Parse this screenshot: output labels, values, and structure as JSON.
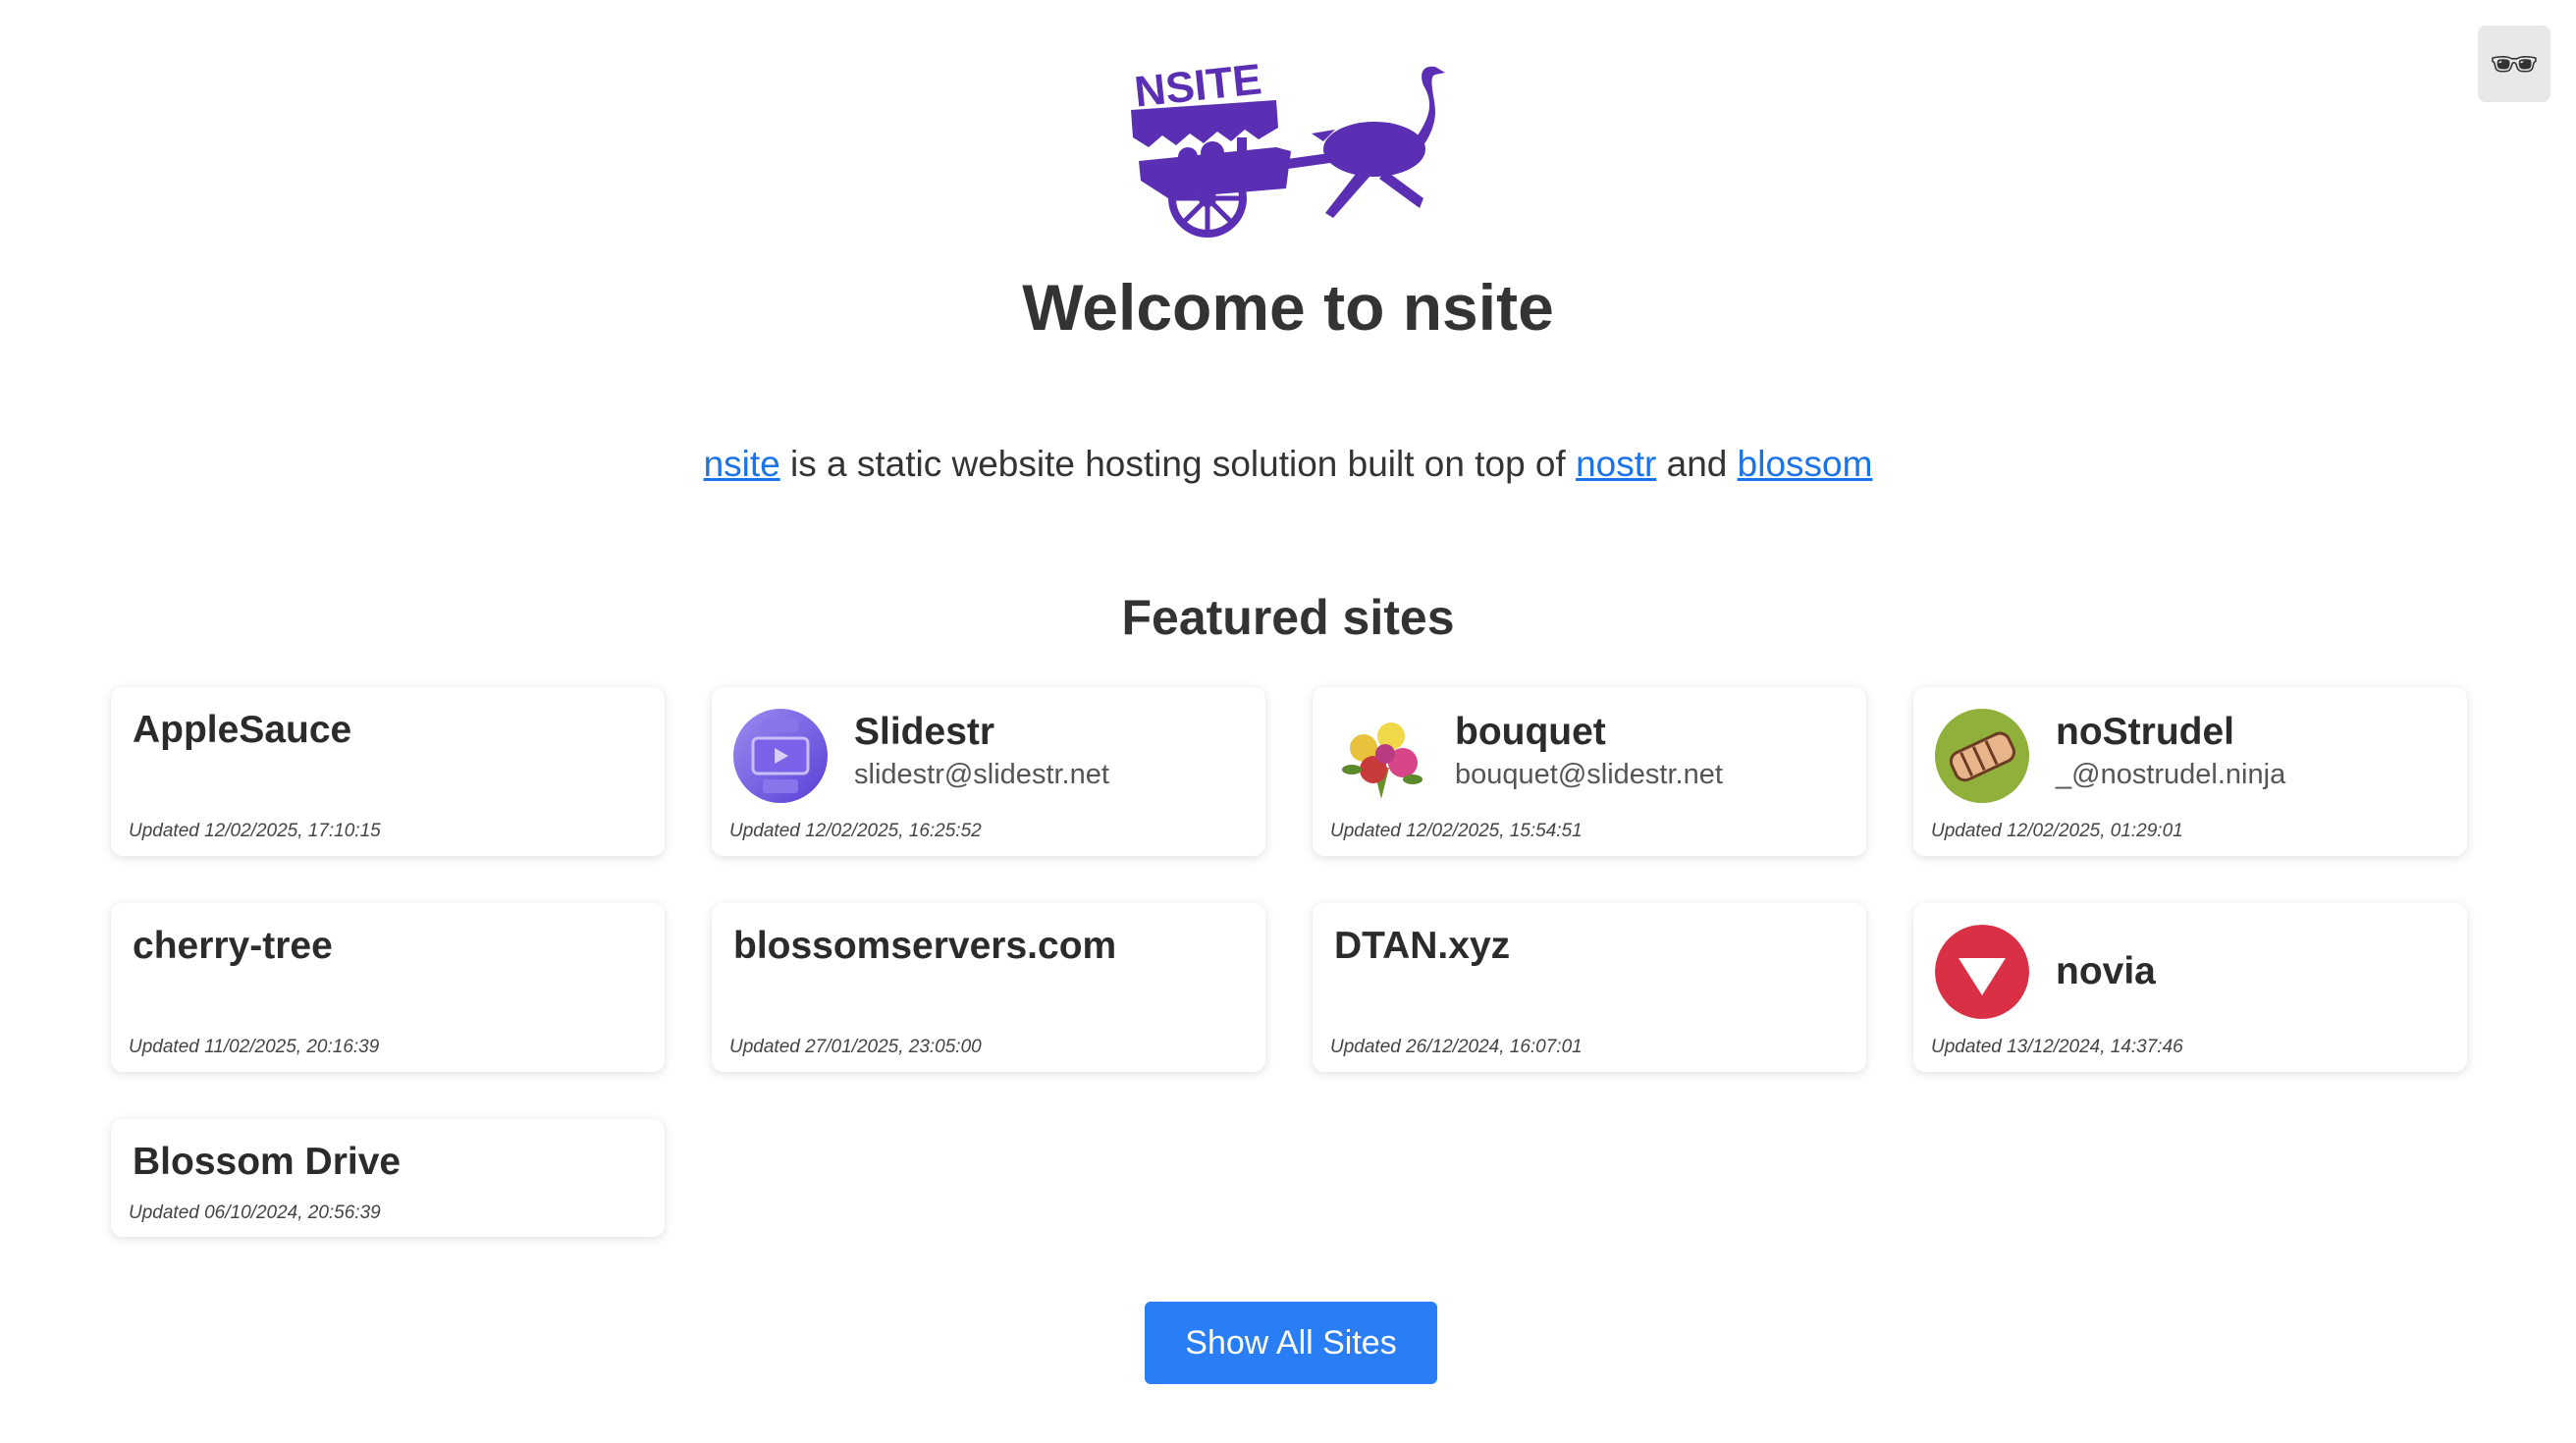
{
  "header": {
    "login_icon": "sunglasses-icon",
    "login_glyph": "🕶",
    "logo_text": "NSITE",
    "brand_color": "#5b2fb3"
  },
  "welcome": {
    "title": "Welcome to nsite"
  },
  "intro": {
    "link_nsite": "nsite",
    "text_middle": " is a static website hosting solution built on top of ",
    "link_nostr": "nostr",
    "text_and": " and ",
    "link_blossom": "blossom"
  },
  "featured": {
    "title": "Featured sites",
    "sites": [
      {
        "name": "AppleSauce",
        "sub": "",
        "updated": "Updated 12/02/2025, 17:10:15",
        "icon": ""
      },
      {
        "name": "Slidestr",
        "sub": "slidestr@slidestr.net",
        "updated": "Updated 12/02/2025, 16:25:52",
        "icon": "slidestr-icon"
      },
      {
        "name": "bouquet",
        "sub": "bouquet@slidestr.net",
        "updated": "Updated 12/02/2025, 15:54:51",
        "icon": "bouquet-icon"
      },
      {
        "name": "noStrudel",
        "sub": "_@nostrudel.ninja",
        "updated": "Updated 12/02/2025, 01:29:01",
        "icon": "strudel-icon"
      },
      {
        "name": "cherry-tree",
        "sub": "",
        "updated": "Updated 11/02/2025, 20:16:39",
        "icon": ""
      },
      {
        "name": "blossomservers.com",
        "sub": "",
        "updated": "Updated 27/01/2025, 23:05:00",
        "icon": ""
      },
      {
        "name": "DTAN.xyz",
        "sub": "",
        "updated": "Updated 26/12/2024, 16:07:01",
        "icon": ""
      },
      {
        "name": "novia",
        "sub": "",
        "updated": "Updated 13/12/2024, 14:37:46",
        "icon": "novia-icon"
      },
      {
        "name": "Blossom Drive",
        "sub": "",
        "updated": "Updated 06/10/2024, 20:56:39",
        "icon": ""
      }
    ]
  },
  "actions": {
    "show_all": "Show All Sites"
  },
  "colors": {
    "link": "#1a73e8",
    "button": "#2a7ef5",
    "novia_red": "#d93045",
    "strudel_green": "#8fb03a"
  }
}
